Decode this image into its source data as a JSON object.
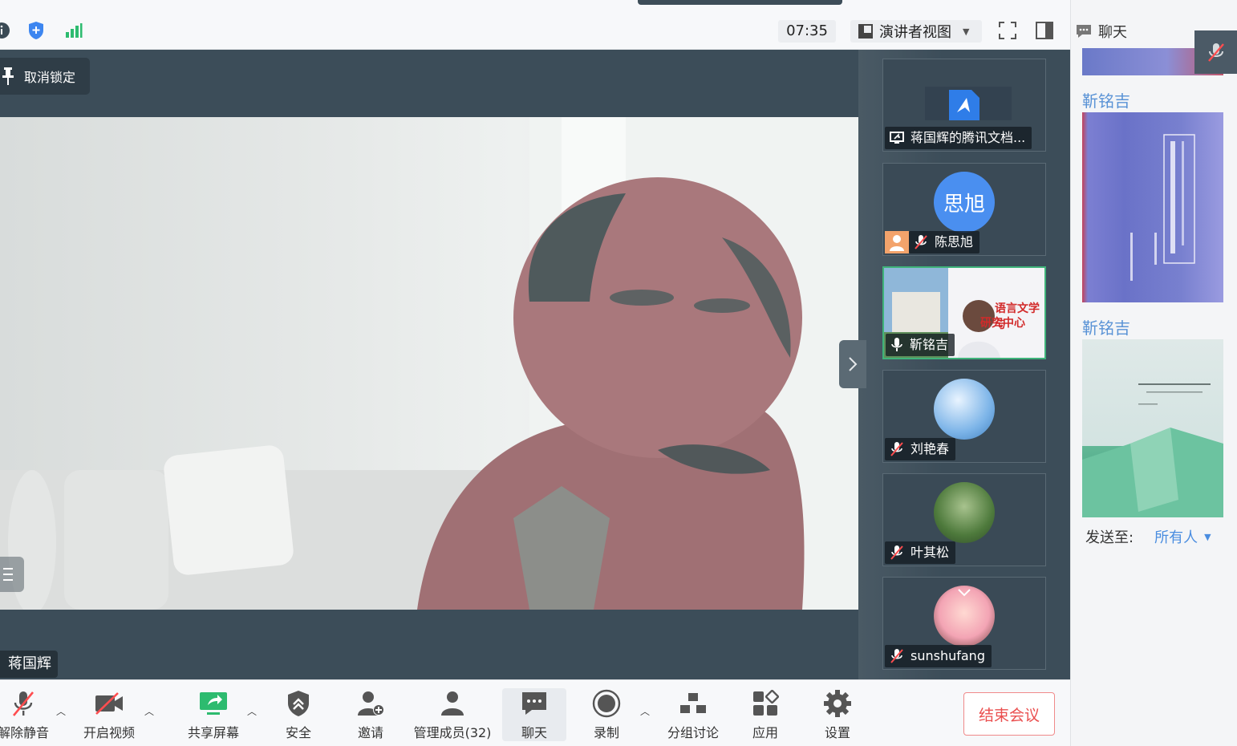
{
  "topbar": {
    "timer": "07:35",
    "view_mode": "演讲者视图"
  },
  "stage": {
    "unlock_label": "取消锁定",
    "speaker_name": "蒋国辉"
  },
  "participants": [
    {
      "name": "蒋国辉的腾讯文档...",
      "type": "share"
    },
    {
      "name": "陈思旭",
      "avatar_text": "思旭",
      "avatar_color": "#4a8ff0",
      "type": "muted"
    },
    {
      "name": "靳铭吉",
      "type": "active",
      "screen_text_line1": "语言文学与",
      "screen_text_line2": "研究中心"
    },
    {
      "name": "刘艳春",
      "type": "muted"
    },
    {
      "name": "叶其松",
      "type": "muted"
    },
    {
      "name": "sunshufang",
      "type": "muted"
    }
  ],
  "toolbar": {
    "unmute": "解除静音",
    "video": "开启视频",
    "share": "共享屏幕",
    "security": "安全",
    "invite": "邀请",
    "members": "管理成员(32)",
    "chat": "聊天",
    "record": "录制",
    "breakout": "分组讨论",
    "apps": "应用",
    "settings": "设置",
    "end_meeting": "结束会议"
  },
  "chat": {
    "title": "聊天",
    "messages": [
      {
        "sender": "靳铭吉"
      },
      {
        "sender": "靳铭吉"
      }
    ],
    "send_to_label": "发送至:",
    "send_to_target": "所有人"
  },
  "colors": {
    "stage_bg": "#3c4d59",
    "active_border": "#3fb37a",
    "end_red": "#ea4f4f",
    "link_blue": "#4a8de0"
  }
}
